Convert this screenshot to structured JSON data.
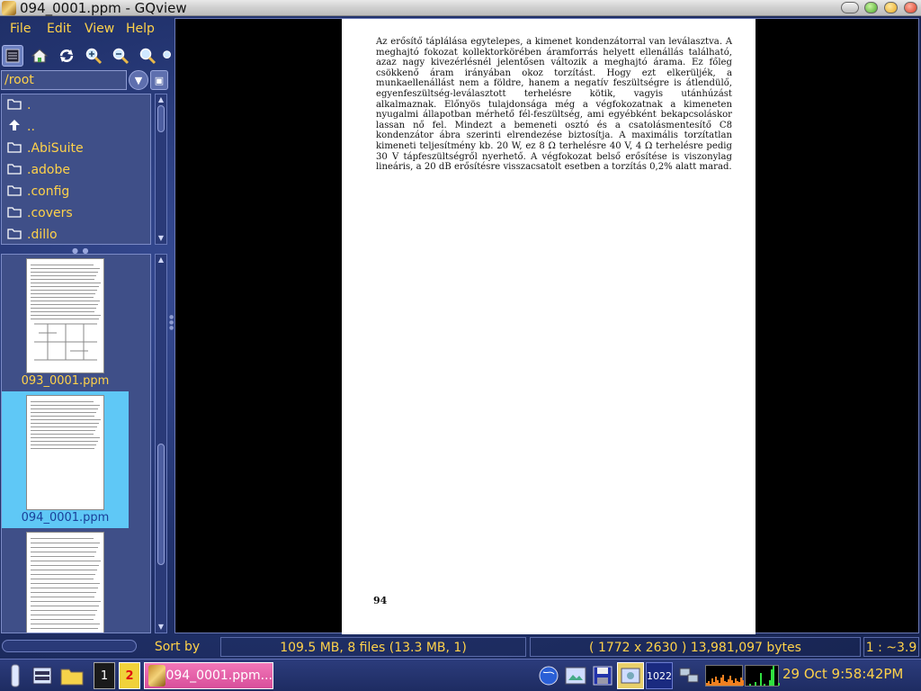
{
  "window": {
    "title": "094_0001.ppm - GQview"
  },
  "menu": [
    "File",
    "Edit",
    "View",
    "Help"
  ],
  "toolbar": {
    "icons": [
      "thumbnails-toggle-icon",
      "home-icon",
      "refresh-icon",
      "zoom-in-icon",
      "zoom-out-icon",
      "zoom-fit-icon",
      "zoom-original-icon"
    ]
  },
  "path": {
    "value": "/root"
  },
  "dirs": [
    {
      "icon": "open-folder-icon",
      "label": "."
    },
    {
      "icon": "up-arrow-icon",
      "label": ".."
    },
    {
      "icon": "folder-icon",
      "label": ".AbiSuite"
    },
    {
      "icon": "folder-icon",
      "label": ".adobe"
    },
    {
      "icon": "folder-icon",
      "label": ".config"
    },
    {
      "icon": "folder-icon",
      "label": ".covers"
    },
    {
      "icon": "folder-icon",
      "label": ".dillo"
    }
  ],
  "thumbs": [
    {
      "name": "093_0001.ppm",
      "selected": false
    },
    {
      "name": "094_0001.ppm",
      "selected": true
    },
    {
      "name": "",
      "selected": false
    }
  ],
  "image": {
    "text": "Az erősítő táplálása egytelepes, a kimenet kondenzátorral van leválasztva. A meghajtó fokozat kollektorkörében áramforrás helyett ellenállás található, azaz nagy kivezérlésnél jelentősen változik a meghajtó árama. Ez főleg csökkenő áram irányában okoz torzítást. Hogy ezt elkerüljék, a munkaellenállást nem a földre, hanem a negatív feszültségre is átlendülő, egyenfeszültség-leválasztott terhelésre kötik, vagyis utánhúzást alkalmaznak. Előnyös tulajdonsága még a végfokozatnak a kimeneten nyugalmi állapotban mérhető fél-feszültség, ami egyébként bekapcsoláskor lassan nő fel. Mindezt a bemeneti osztó és a csatolásmentesítő C8 kondenzátor ábra szerinti elrendezése biztosítja. A maximális torzítatlan kimeneti teljesítmény kb. 20 W, ez 8 Ω terhelésre 40 V, 4 Ω terhelésre pedig 30 V tápfeszültségről nyerhető. A végfokozat belső erősítése is viszonylag lineáris, a 20 dB erősítésre visszacsatolt esetben a torzítás 0,2% alatt marad.",
    "page_number": "94"
  },
  "status": {
    "sort": "Sort by name",
    "files": "109.5 MB, 8 files (13.3 MB, 1)",
    "info": "( 1772 x 2630 ) 13,981,097 bytes",
    "zoom": "1 : ~3.9"
  },
  "taskbar": {
    "workspace1": "1",
    "workspace2": "2",
    "active_task": "094_0001.ppm...",
    "cpu_readout": "1022",
    "clock": "29 Oct  9:58:42PM"
  },
  "colors": {
    "accent_text": "#ffd24a",
    "selection": "#5fc8f6",
    "task_active": "#e565aa"
  }
}
